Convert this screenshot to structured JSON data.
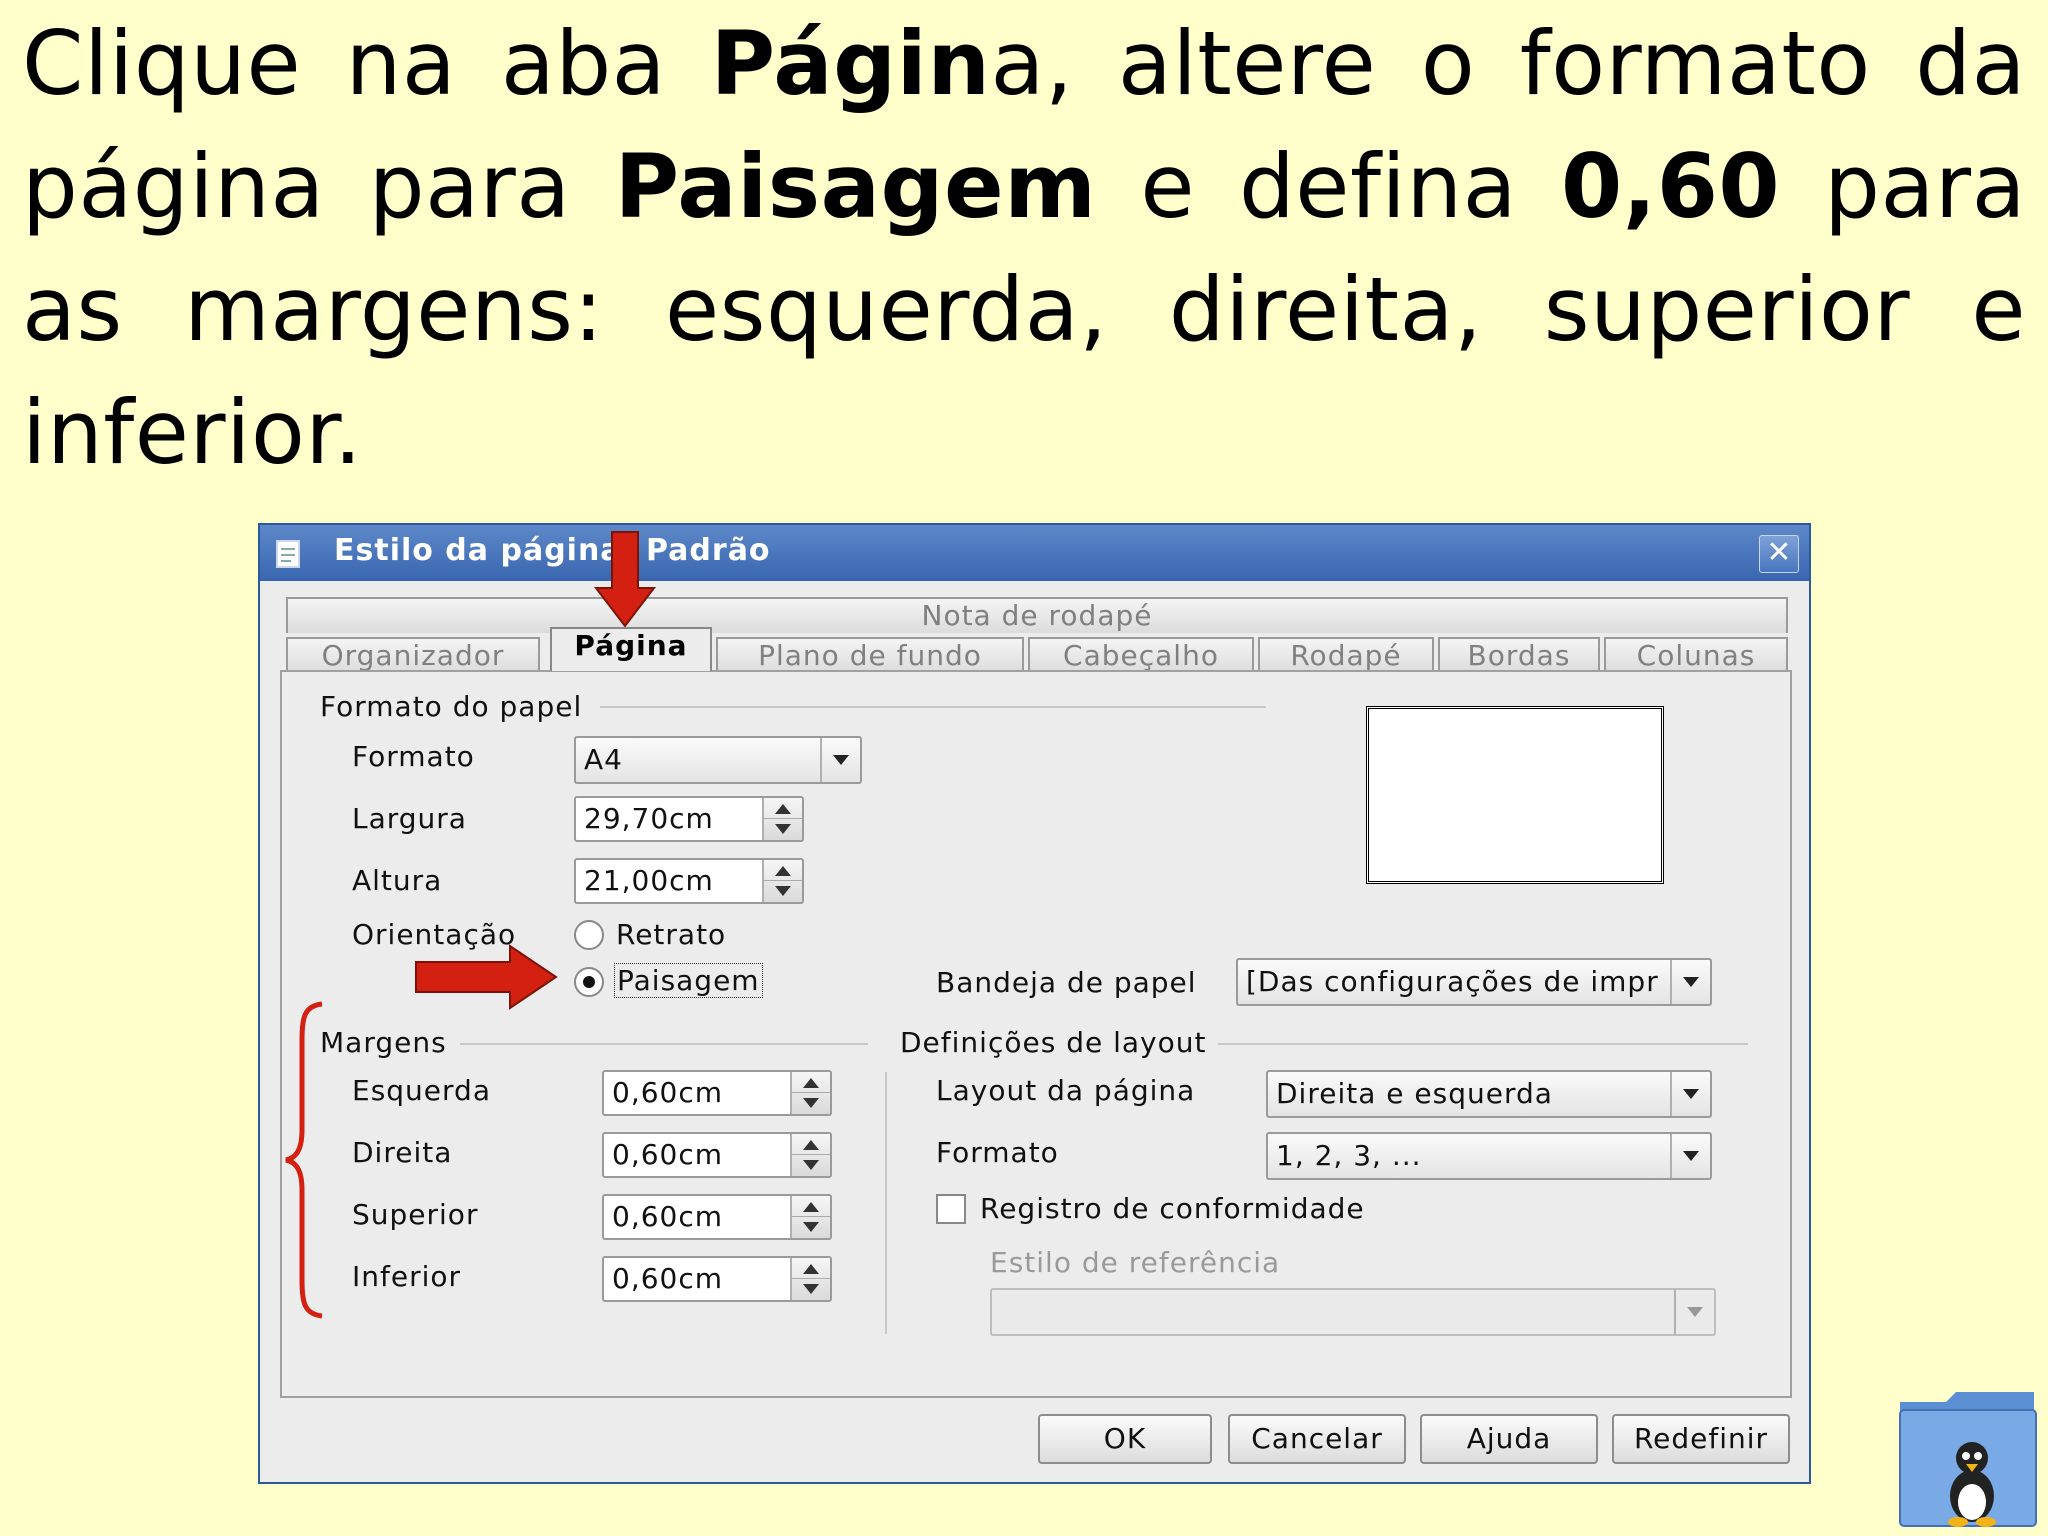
{
  "instruction": {
    "p1": "Clique na aba ",
    "b1": "Págin",
    "p2": "a, altere o formato da página para ",
    "b2": "Paisagem",
    "p3": " e defina ",
    "b3": "0,60",
    "p4": " para as margens: esquerda, direita, superior e inferior."
  },
  "dialog": {
    "title": "Estilo da página: Padrão",
    "tabs_row1": [
      "Nota de rodapé"
    ],
    "tabs_row2": [
      "Organizador",
      "Página",
      "Plano de fundo",
      "Cabeçalho",
      "Rodapé",
      "Bordas",
      "Colunas"
    ],
    "active_tab": "Página",
    "paper_format": {
      "group_label": "Formato do papel",
      "format_label": "Formato",
      "format_value": "A4",
      "width_label": "Largura",
      "width_value": "29,70cm",
      "height_label": "Altura",
      "height_value": "21,00cm",
      "orientation_label": "Orientação",
      "portrait_label": "Retrato",
      "landscape_label": "Paisagem",
      "orientation_selected": "Paisagem",
      "paper_tray_label": "Bandeja de papel",
      "paper_tray_value": "[Das configurações de impr"
    },
    "margins": {
      "group_label": "Margens",
      "left_label": "Esquerda",
      "left_value": "0,60cm",
      "right_label": "Direita",
      "right_value": "0,60cm",
      "top_label": "Superior",
      "top_value": "0,60cm",
      "bottom_label": "Inferior",
      "bottom_value": "0,60cm"
    },
    "layout": {
      "group_label": "Definições de layout",
      "page_layout_label": "Layout da página",
      "page_layout_value": "Direita e esquerda",
      "format_label": "Formato",
      "format_value": "1, 2, 3, ...",
      "register_true_label": "Registro de conformidade",
      "register_true_checked": false,
      "reference_style_label": "Estilo de referência",
      "reference_style_value": ""
    },
    "buttons": {
      "ok": "OK",
      "cancel": "Cancelar",
      "help": "Ajuda",
      "reset": "Redefinir"
    }
  },
  "colors": {
    "slide_background": "#ffffcc",
    "titlebar": "#3a66b0",
    "annotation_red": "#d42010"
  },
  "icons": [
    "document-icon",
    "close-icon",
    "linux-folder-icon",
    "red-arrow-icon",
    "brace-icon"
  ]
}
